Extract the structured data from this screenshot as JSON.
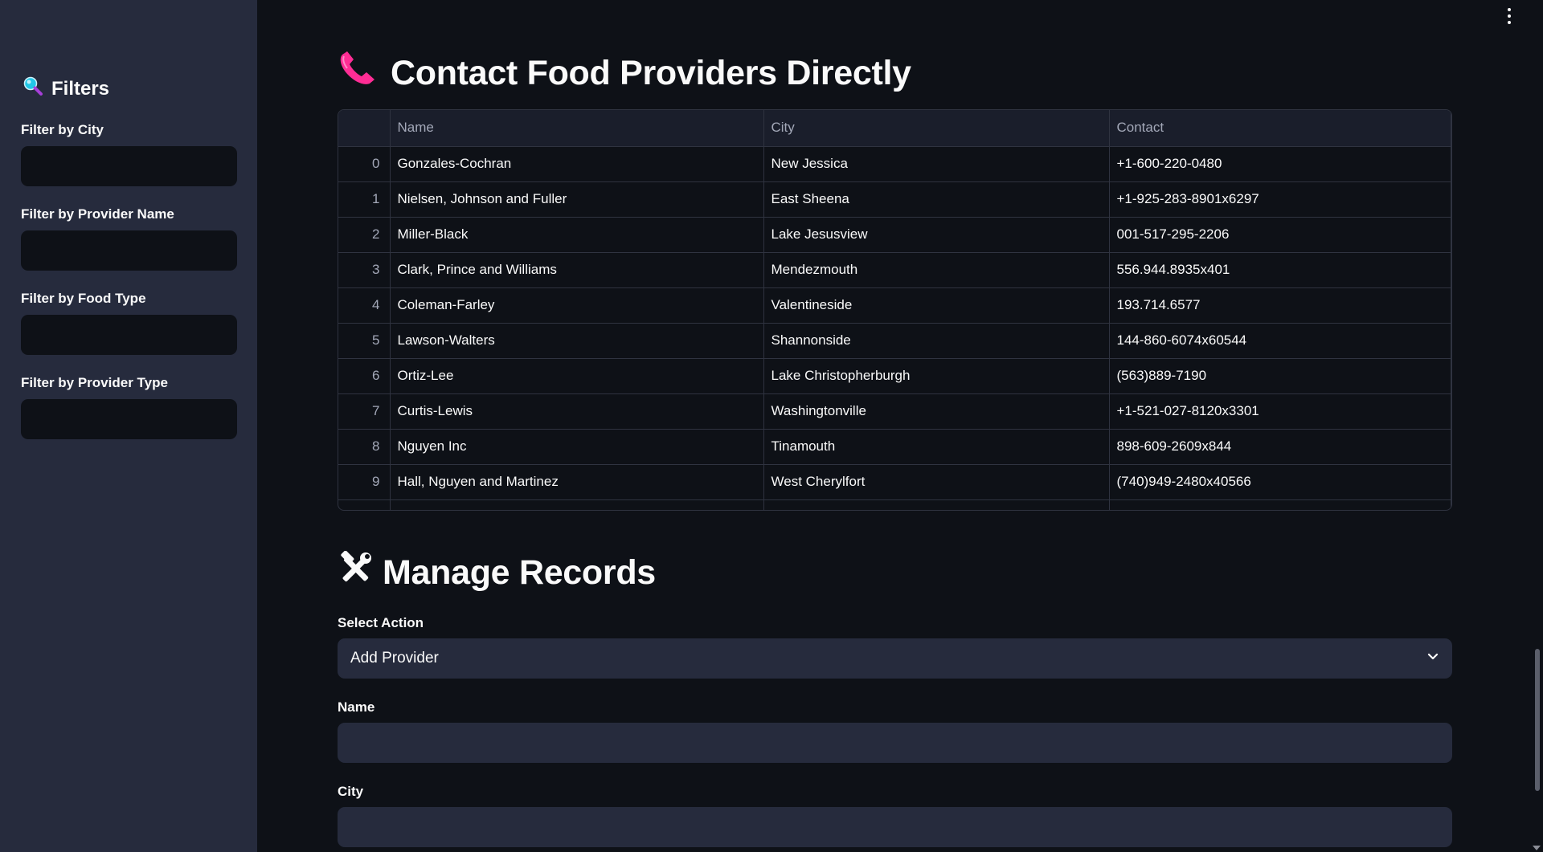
{
  "sidebar": {
    "title": "Filters",
    "filters": [
      {
        "label": "Filter by City",
        "value": ""
      },
      {
        "label": "Filter by Provider Name",
        "value": ""
      },
      {
        "label": "Filter by Food Type",
        "value": ""
      },
      {
        "label": "Filter by Provider Type",
        "value": ""
      }
    ]
  },
  "main": {
    "contact_heading": "Contact Food Providers Directly",
    "table": {
      "columns": [
        "",
        "Name",
        "City",
        "Contact"
      ],
      "rows": [
        [
          "0",
          "Gonzales-Cochran",
          "New Jessica",
          "+1-600-220-0480"
        ],
        [
          "1",
          "Nielsen, Johnson and Fuller",
          "East Sheena",
          "+1-925-283-8901x6297"
        ],
        [
          "2",
          "Miller-Black",
          "Lake Jesusview",
          "001-517-295-2206"
        ],
        [
          "3",
          "Clark, Prince and Williams",
          "Mendezmouth",
          "556.944.8935x401"
        ],
        [
          "4",
          "Coleman-Farley",
          "Valentineside",
          "193.714.6577"
        ],
        [
          "5",
          "Lawson-Walters",
          "Shannonside",
          "144-860-6074x60544"
        ],
        [
          "6",
          "Ortiz-Lee",
          "Lake Christopherburgh",
          "(563)889-7190"
        ],
        [
          "7",
          "Curtis-Lewis",
          "Washingtonville",
          "+1-521-027-8120x3301"
        ],
        [
          "8",
          "Nguyen Inc",
          "Tinamouth",
          "898-609-2609x844"
        ],
        [
          "9",
          "Hall, Nguyen and Martinez",
          "West Cherylfort",
          "(740)949-2480x40566"
        ]
      ]
    },
    "manage_heading": "Manage Records",
    "select_action": {
      "label": "Select Action",
      "value": "Add Provider"
    },
    "name_field": {
      "label": "Name",
      "value": ""
    },
    "city_field": {
      "label": "City",
      "value": ""
    }
  },
  "colors": {
    "background": "#0e1117",
    "sidebar": "#262b3d",
    "input": "#262b3d",
    "phone_icon": "#ff2d95",
    "search_icon": "#21c7e8"
  },
  "icons": {
    "filters": "magnifier-icon",
    "contact": "telephone-receiver-icon",
    "manage": "hammer-and-wrench-icon",
    "menu": "kebab-menu-icon",
    "select": "chevron-down-icon"
  }
}
